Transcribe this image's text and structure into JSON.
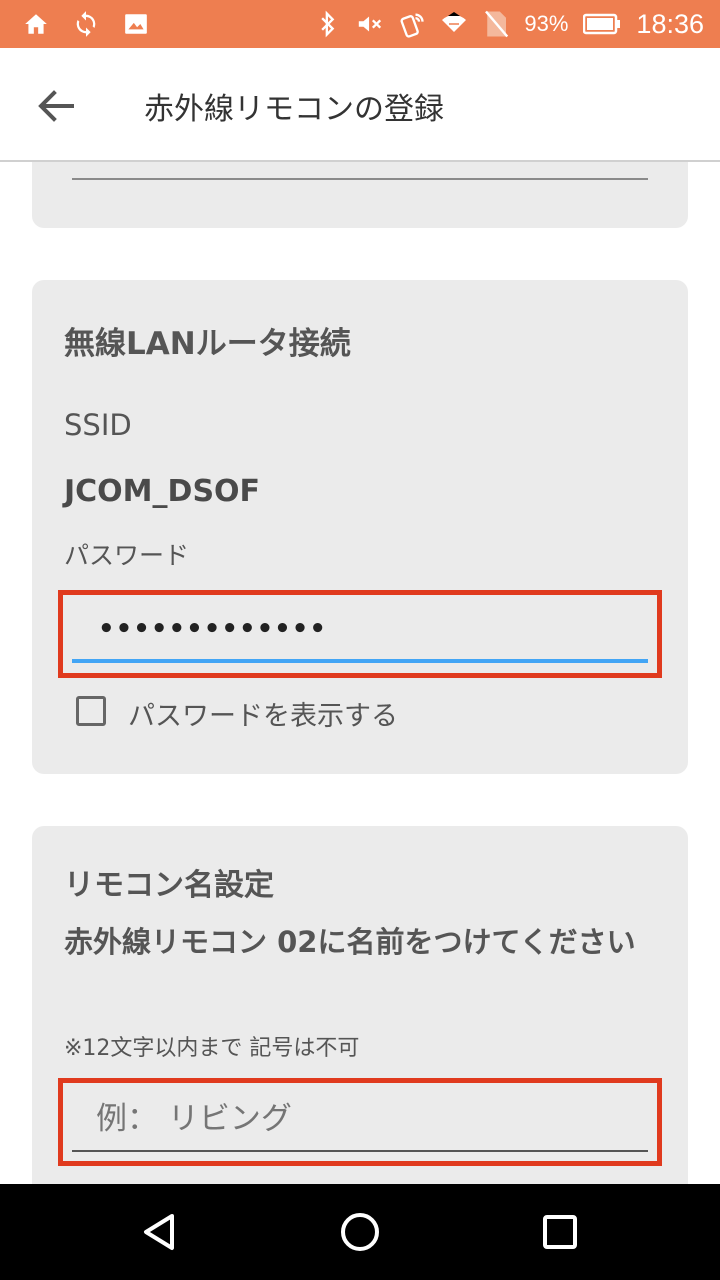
{
  "status_bar": {
    "battery_text": "93%",
    "time": "18:36",
    "left_icons": [
      "home-icon",
      "sync-icon",
      "image-icon"
    ],
    "right_icons": [
      "bluetooth-icon",
      "mute-icon",
      "nfc-icon",
      "wifi-icon",
      "no-sim-icon",
      "battery-icon"
    ],
    "color": "#ee7e50"
  },
  "header": {
    "title": "赤外線リモコンの登録",
    "back_icon": "back-arrow-icon"
  },
  "wifi_card": {
    "heading": "無線LANルータ接続",
    "ssid_label": "SSID",
    "ssid_value": "JCOM_DSOF",
    "password_label": "パスワード",
    "password_value": "•••••••••••••",
    "show_password_label": "パスワードを表示する",
    "show_password_checked": false
  },
  "name_card": {
    "heading": "リモコン名設定",
    "instruction": "赤外線リモコン 02に名前をつけてください",
    "note": "※12文字以内まで 記号は不可",
    "name_placeholder": "例： リビング"
  },
  "colors": {
    "accent_blue": "#42a5f5",
    "highlight_red": "#e03a1e",
    "card_bg": "#ebebeb"
  }
}
